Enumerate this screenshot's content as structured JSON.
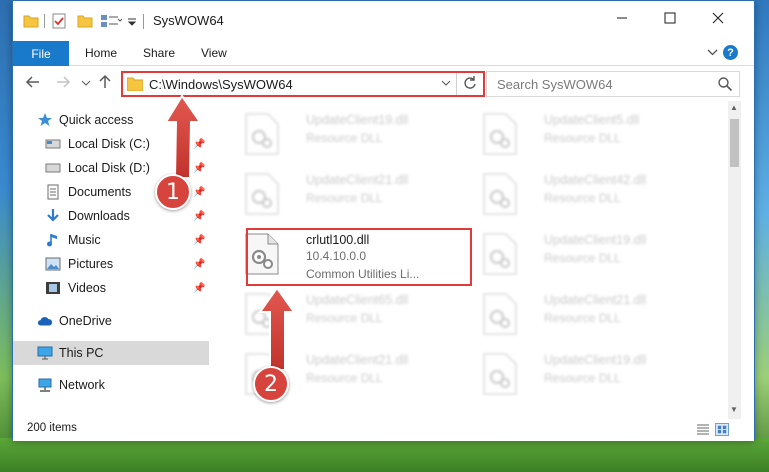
{
  "window": {
    "title": "SysWOW64"
  },
  "ribbon": {
    "tabs": [
      "File",
      "Home",
      "Share",
      "View"
    ]
  },
  "address": {
    "path": "C:\\Windows\\SysWOW64"
  },
  "search": {
    "placeholder": "Search SysWOW64"
  },
  "sidebar": {
    "items": [
      {
        "label": "Quick access",
        "icon": "star-icon"
      },
      {
        "label": "Local Disk (C:)",
        "icon": "drive-icon",
        "pinned": true
      },
      {
        "label": "Local Disk (D:)",
        "icon": "drive-icon",
        "pinned": true
      },
      {
        "label": "Documents",
        "icon": "documents-icon",
        "pinned": true
      },
      {
        "label": "Downloads",
        "icon": "download-icon",
        "pinned": true
      },
      {
        "label": "Music",
        "icon": "music-icon",
        "pinned": true
      },
      {
        "label": "Pictures",
        "icon": "pictures-icon",
        "pinned": true
      },
      {
        "label": "Videos",
        "icon": "videos-icon",
        "pinned": true
      },
      {
        "label": "OneDrive",
        "icon": "cloud-icon"
      },
      {
        "label": "This PC",
        "icon": "computer-icon"
      },
      {
        "label": "Network",
        "icon": "network-icon"
      }
    ]
  },
  "files": [
    {
      "name": "UpdateClient19.dll",
      "desc": "Resource DLL"
    },
    {
      "name": "UpdateClient5.dll",
      "desc": "Resource DLL"
    },
    {
      "name": "UpdateClient21.dll",
      "desc": "Resource DLL"
    },
    {
      "name": "UpdateClient42.dll",
      "desc": "Resource DLL"
    },
    {
      "name": "crlutl100.dll",
      "version": "10.4.10.0.0",
      "desc": "Common Utilities Li..."
    },
    {
      "name": "UpdateClient19.dll",
      "desc": "Resource DLL"
    },
    {
      "name": "UpdateClient65.dll",
      "desc": "Resource DLL"
    },
    {
      "name": "UpdateClient21.dll",
      "desc": "Resource DLL"
    },
    {
      "name": "UpdateClient21.dll",
      "desc": "Resource DLL"
    },
    {
      "name": "UpdateClient19.dll",
      "desc": "Resource DLL"
    }
  ],
  "status": {
    "count": "200 items"
  },
  "annotations": {
    "step1": "1",
    "step2": "2"
  },
  "colors": {
    "accent": "#1979ca",
    "highlight": "#e03a3a"
  }
}
